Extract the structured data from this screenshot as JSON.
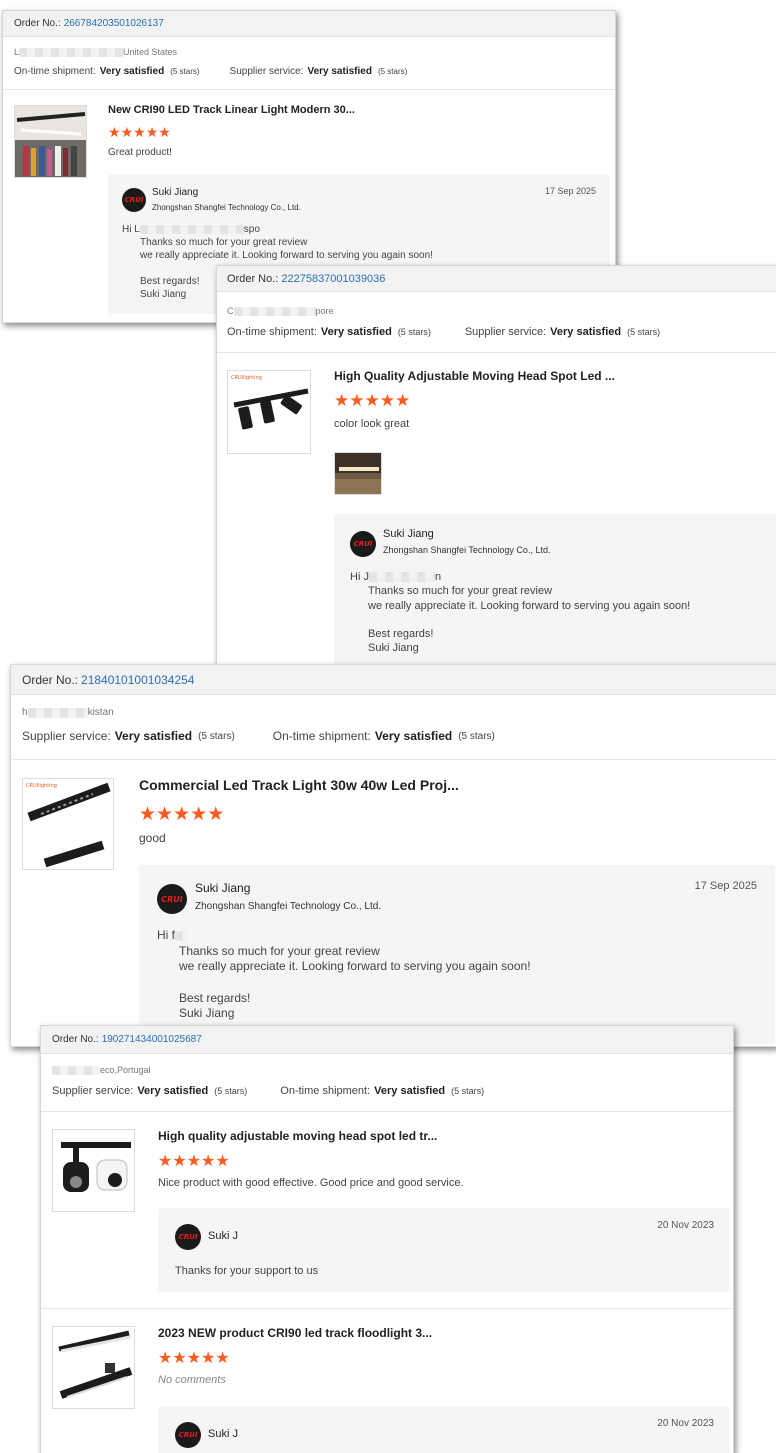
{
  "accent": "#ff5a1f",
  "link_color": "#2a6fb5",
  "cards": [
    {
      "order_label": "Order No.:",
      "order_number": "266784203501026137",
      "location_visible": "United States",
      "location_prefix": "L",
      "sat_1_key": "On-time shipment:",
      "sat_1_val": "Very satisfied",
      "sat_1_stars": "(5 stars)",
      "sat_2_key": "Supplier service:",
      "sat_2_val": "Very satisfied",
      "sat_2_stars": "(5 stars)",
      "product_title": "New CRI90 LED Track Linear Light Modern 30...",
      "rating": 5,
      "comment": "Great product!",
      "reply": {
        "name": "Suki Jiang",
        "company": "Zhongshan Shangfei Technology Co., Ltd.",
        "date": "17 Sep 2025",
        "greeting_prefix": "Hi L",
        "greeting_suffix": "spo",
        "line1": "Thanks so much for your great review",
        "line2": "we really appreciate it. Looking forward to serving you again soon!",
        "regards": "Best regards!",
        "sign": "Suki Jiang"
      }
    },
    {
      "order_label": "Order No.:",
      "order_number": "22275837001039036",
      "location_prefix": "C",
      "location_visible": "pore",
      "sat_1_key": "On-time shipment:",
      "sat_1_val": "Very satisfied",
      "sat_1_stars": "(5 stars)",
      "sat_2_key": "Supplier service:",
      "sat_2_val": "Very satisfied",
      "sat_2_stars": "(5 stars)",
      "product_title": "High Quality Adjustable Moving Head Spot Led ...",
      "rating": 5,
      "comment": "color look great",
      "reply": {
        "name": "Suki Jiang",
        "company": "Zhongshan Shangfei Technology Co., Ltd.",
        "greeting_prefix": "Hi J",
        "greeting_suffix": "n",
        "line1": "Thanks so much for your great review",
        "line2": "we really appreciate it. Looking forward to serving you again soon!",
        "regards": "Best regards!",
        "sign": "Suki Jiang"
      }
    },
    {
      "order_label": "Order No.:",
      "order_number": "21840101001034254",
      "location_prefix": "h",
      "location_visible": "kistan",
      "sat_1_key": "Supplier service:",
      "sat_1_val": "Very satisfied",
      "sat_1_stars": "(5 stars)",
      "sat_2_key": "On-time shipment:",
      "sat_2_val": "Very satisfied",
      "sat_2_stars": "(5 stars)",
      "product_title": "Commercial Led Track Light 30w 40w Led Proj...",
      "rating": 5,
      "comment": "good",
      "reply": {
        "name": "Suki Jiang",
        "company": "Zhongshan Shangfei Technology Co., Ltd.",
        "date": "17 Sep 2025",
        "greeting_prefix": "Hi f",
        "line1": "Thanks so much for your great review",
        "line2": "we really appreciate it. Looking forward to serving you again soon!",
        "regards": "Best regards!",
        "sign": "Suki Jiang"
      }
    },
    {
      "order_label": "Order No.:",
      "order_number": "190271434001025687",
      "location_visible": "eco,Portugal",
      "sat_1_key": "Supplier service:",
      "sat_1_val": "Very satisfied",
      "sat_1_stars": "(5 stars)",
      "sat_2_key": "On-time shipment:",
      "sat_2_val": "Very satisfied",
      "sat_2_stars": "(5 stars)",
      "items": [
        {
          "product_title": "High quality adjustable moving head spot led tr...",
          "rating": 5,
          "comment": "Nice product with good effective. Good price and good service.",
          "reply": {
            "name": "Suki J",
            "date": "20 Nov 2023",
            "text": "Thanks for your support to us"
          }
        },
        {
          "product_title": "2023 NEW product CRI90 led track floodlight 3...",
          "rating": 5,
          "comment": "No comments",
          "reply": {
            "name": "Suki J",
            "date": "20 Nov 2023"
          }
        }
      ]
    }
  ],
  "avatar_logo_text": "CRUI",
  "star_glyph": "★"
}
